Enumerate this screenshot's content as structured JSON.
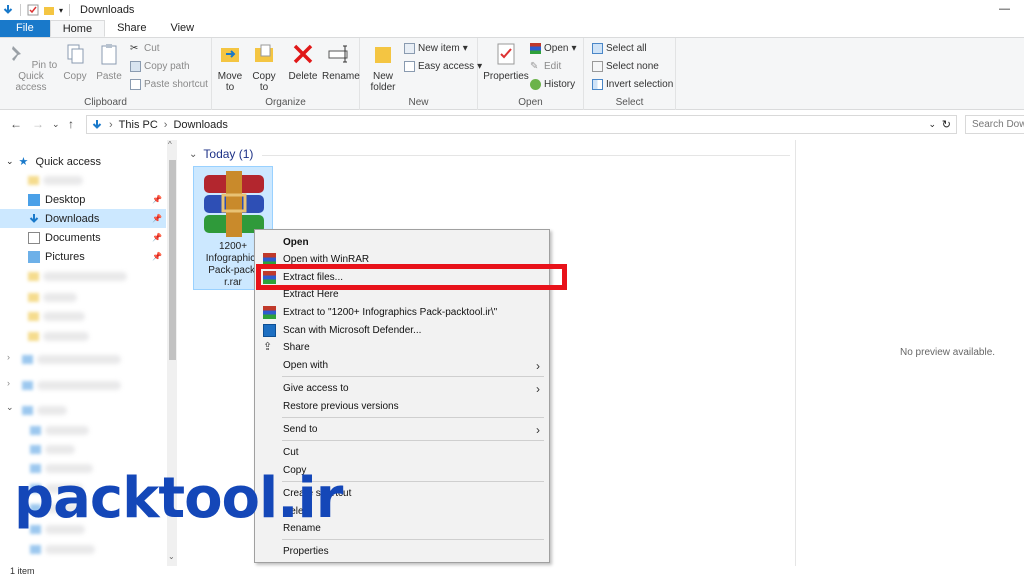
{
  "window": {
    "title": "Downloads"
  },
  "tabs": [
    "File",
    "Home",
    "Share",
    "View"
  ],
  "ribbon": {
    "clipboard": {
      "label": "Clipboard",
      "pin": "Pin to Quick access",
      "copy": "Copy",
      "paste": "Paste",
      "cut": "Cut",
      "copy_path": "Copy path",
      "paste_shortcut": "Paste shortcut"
    },
    "organize": {
      "label": "Organize",
      "move_to": "Move to",
      "copy_to": "Copy to",
      "delete": "Delete",
      "rename": "Rename"
    },
    "new": {
      "label": "New",
      "new_folder": "New folder",
      "new_item": "New item",
      "easy_access": "Easy access"
    },
    "open": {
      "label": "Open",
      "properties": "Properties",
      "open": "Open",
      "edit": "Edit",
      "history": "History"
    },
    "select": {
      "label": "Select",
      "select_all": "Select all",
      "select_none": "Select none",
      "invert": "Invert selection"
    }
  },
  "address": {
    "crumbs": [
      "This PC",
      "Downloads"
    ],
    "search_placeholder": "Search Downloads"
  },
  "nav": {
    "quick_access": "Quick access",
    "items": [
      {
        "label": "Desktop"
      },
      {
        "label": "Downloads"
      },
      {
        "label": "Documents"
      },
      {
        "label": "Pictures"
      }
    ]
  },
  "content": {
    "group_header": "Today (1)",
    "file_name": "1200+ Infographics Pack-packtool.ir.rar",
    "file_name_lines": [
      "1200+",
      "Infographics",
      "Pack-packt",
      "r.rar"
    ]
  },
  "preview": {
    "text": "No preview available."
  },
  "status": {
    "count": "1 item"
  },
  "context_menu": {
    "items": [
      {
        "label": "Open",
        "bold": true
      },
      {
        "label": "Open with WinRAR"
      },
      {
        "label": "Extract files..."
      },
      {
        "label": "Extract Here"
      },
      {
        "label": "Extract to \"1200+ Infographics Pack-packtool.ir\\\""
      },
      {
        "label": "Scan with Microsoft Defender..."
      },
      {
        "label": "Share"
      },
      {
        "label": "Open with"
      },
      {
        "label": "Give access to"
      },
      {
        "label": "Restore previous versions"
      },
      {
        "label": "Send to"
      },
      {
        "label": "Cut"
      },
      {
        "label": "Copy"
      },
      {
        "label": "Create shortcut"
      },
      {
        "label": "Delete"
      },
      {
        "label": "Rename"
      },
      {
        "label": "Properties"
      }
    ]
  },
  "watermark": "packtool.ir",
  "colors": {
    "accent": "#1979ca",
    "selection": "#cce8ff",
    "highlight": "#e8121a",
    "watermark": "#1447b8"
  }
}
